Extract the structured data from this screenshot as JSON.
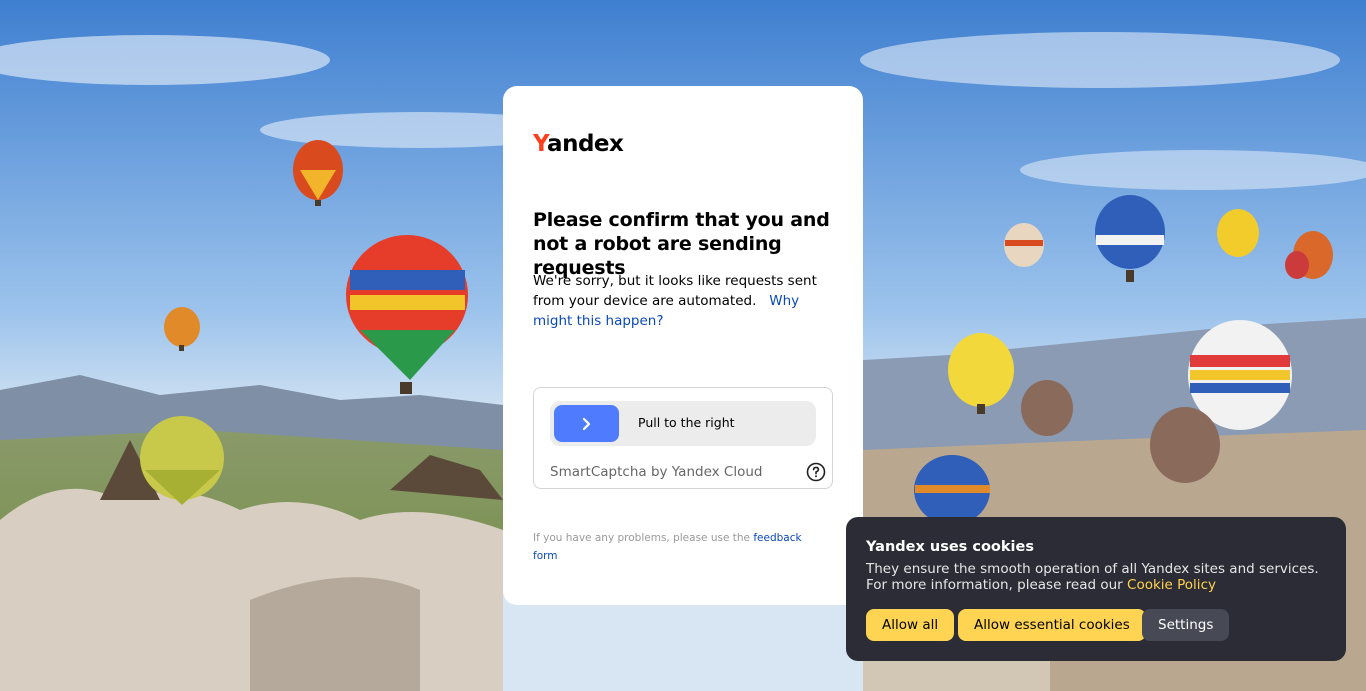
{
  "background": {
    "description_icon": "hot-air-balloons-landscape"
  },
  "card": {
    "logo_first": "Y",
    "logo_rest": "andex",
    "title": "Please confirm that you and not a robot are sending requests",
    "description": "We're sorry, but it looks like requests sent from your device are automated.",
    "why_link": "Why might this happen?",
    "slider_label": "Pull to the right",
    "captcha_label": "SmartCaptcha by Yandex Cloud",
    "feedback_text": "If you have any problems, please use the",
    "feedback_link": "feedback form"
  },
  "cookies": {
    "title": "Yandex uses cookies",
    "text": "They ensure the smooth operation of all Yandex sites and services. For more information, please read our",
    "policy_link": "Cookie Policy",
    "allow_all": "Allow all",
    "allow_essential": "Allow essential cookies",
    "settings": "Settings"
  },
  "colors": {
    "brand_red": "#fc3f1d",
    "link_blue": "#0b49b8",
    "slider_blue": "#4f7cff",
    "cookie_yellow": "#fed452",
    "cookie_panel": "#2b2c35"
  }
}
